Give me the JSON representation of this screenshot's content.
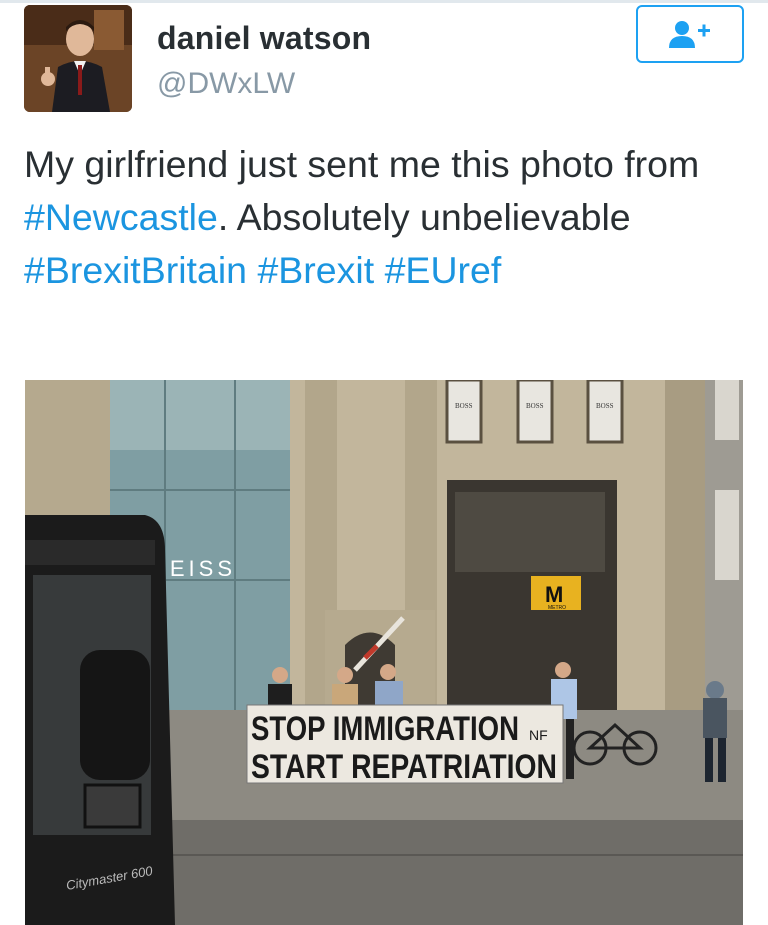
{
  "user": {
    "display_name": "daniel watson",
    "handle": "@DWxLW"
  },
  "follow_button": {
    "icon": "add-user-icon",
    "color": "#1da1f2"
  },
  "tweet": {
    "segments": [
      {
        "text": "My girlfriend just sent me this photo from ",
        "type": "text"
      },
      {
        "text": "#Newcastle",
        "type": "hashtag"
      },
      {
        "text": ". Absolutely unbelievable ",
        "type": "text"
      },
      {
        "text": "#BrexitBritain",
        "type": "hashtag"
      },
      {
        "text": " ",
        "type": "text"
      },
      {
        "text": "#Brexit",
        "type": "hashtag"
      },
      {
        "text": " ",
        "type": "text"
      },
      {
        "text": "#EUref",
        "type": "hashtag"
      }
    ]
  },
  "photo": {
    "store_sign": "REISS",
    "metro_sign": "M",
    "metro_label": "METRO",
    "shop_signs": [
      "BOSS",
      "BOSS",
      "BOSS"
    ],
    "banner_line1": "STOP IMMIGRATION",
    "banner_line2": "START REPATRIATION",
    "banner_mark": "NF",
    "vehicle_label": "Citymaster 600"
  },
  "colors": {
    "text": "#292f33",
    "handle": "#8899a6",
    "hashtag": "#1b95e0"
  }
}
